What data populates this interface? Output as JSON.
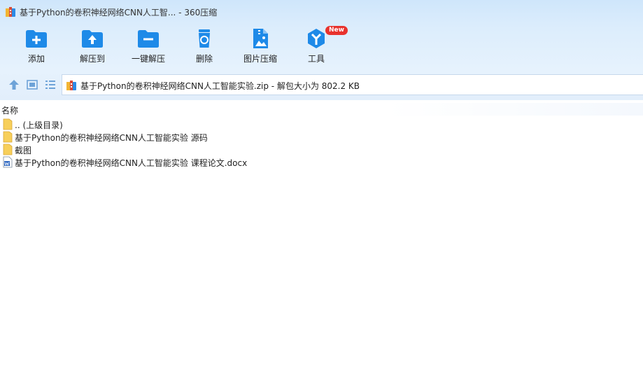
{
  "window": {
    "title": "基于Python的卷积神经网络CNN人工智... - 360压缩"
  },
  "toolbar": {
    "items": [
      {
        "label": "添加",
        "icon": "folder-add-icon"
      },
      {
        "label": "解压到",
        "icon": "folder-extract-icon"
      },
      {
        "label": "一键解压",
        "icon": "folder-minus-icon"
      },
      {
        "label": "删除",
        "icon": "recycle-bin-icon"
      },
      {
        "label": "图片压缩",
        "icon": "image-compress-icon"
      },
      {
        "label": "工具",
        "icon": "tools-icon",
        "badge": "New"
      }
    ]
  },
  "navbar": {
    "path_text": "基于Python的卷积神经网络CNN人工智能实验.zip - 解包大小为 802.2 KB"
  },
  "filelist": {
    "column_name": "名称",
    "rows": [
      {
        "name": ".. (上级目录)",
        "type": "folder"
      },
      {
        "name": "基于Python的卷积神经网络CNN人工智能实验 源码",
        "type": "folder"
      },
      {
        "name": "截图",
        "type": "folder"
      },
      {
        "name": "基于Python的卷积神经网络CNN人工智能实验 课程论文.docx",
        "type": "docx"
      }
    ]
  },
  "colors": {
    "accent": "#1e8ae8",
    "folder": "#f7cf5a",
    "badge": "#e8322d"
  }
}
